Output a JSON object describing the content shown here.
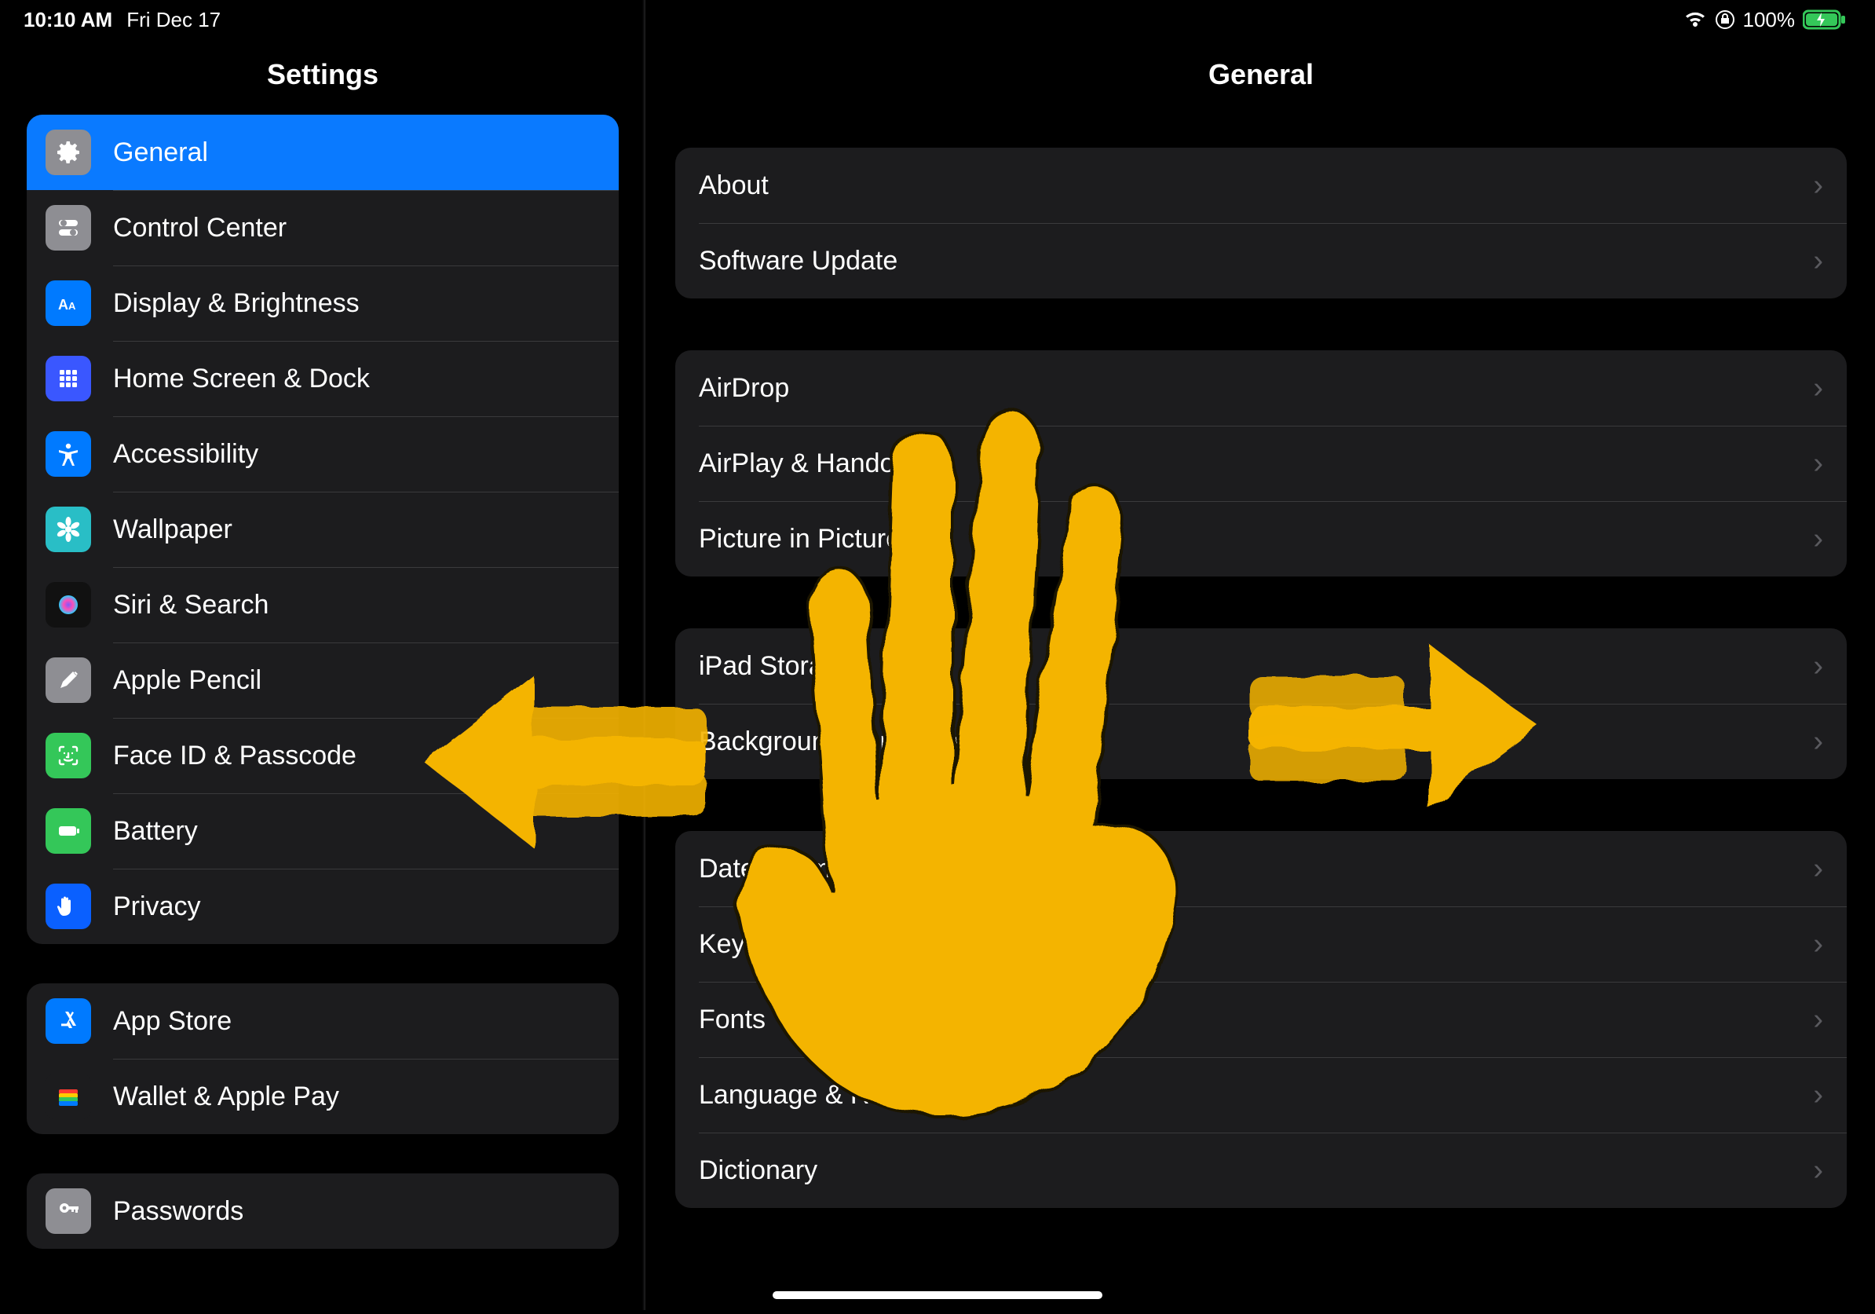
{
  "status": {
    "time": "10:10 AM",
    "date": "Fri Dec 17",
    "battery_percent": "100%",
    "battery_icon": "battery-charging-icon",
    "wifi_icon": "wifi-icon",
    "orientation_lock_icon": "orientation-lock-icon"
  },
  "sidebar": {
    "title": "Settings",
    "groups": [
      {
        "items": [
          {
            "icon": "gear-icon",
            "icon_bg": "ic-gray",
            "label": "General",
            "selected": true
          },
          {
            "icon": "toggles-icon",
            "icon_bg": "ic-gray2",
            "label": "Control Center",
            "selected": false
          },
          {
            "icon": "text-size-icon",
            "icon_bg": "ic-blue",
            "label": "Display & Brightness",
            "selected": false
          },
          {
            "icon": "grid-icon",
            "icon_bg": "ic-grid",
            "label": "Home Screen & Dock",
            "selected": false
          },
          {
            "icon": "accessibility-icon",
            "icon_bg": "ic-blue",
            "label": "Accessibility",
            "selected": false
          },
          {
            "icon": "flower-icon",
            "icon_bg": "ic-teal",
            "label": "Wallpaper",
            "selected": false
          },
          {
            "icon": "siri-icon",
            "icon_bg": "ic-black",
            "label": "Siri & Search",
            "selected": false
          },
          {
            "icon": "pencil-icon",
            "icon_bg": "ic-pencil",
            "label": "Apple Pencil",
            "selected": false
          },
          {
            "icon": "faceid-icon",
            "icon_bg": "ic-face",
            "label": "Face ID & Passcode",
            "selected": false
          },
          {
            "icon": "battery-icon",
            "icon_bg": "ic-green",
            "label": "Battery",
            "selected": false
          },
          {
            "icon": "hand-icon",
            "icon_bg": "ic-hand",
            "label": "Privacy",
            "selected": false
          }
        ]
      },
      {
        "items": [
          {
            "icon": "appstore-icon",
            "icon_bg": "ic-blue",
            "label": "App Store",
            "selected": false
          },
          {
            "icon": "wallet-icon",
            "icon_bg": "ic-wallet",
            "label": "Wallet & Apple Pay",
            "selected": false
          }
        ]
      },
      {
        "items": [
          {
            "icon": "key-icon",
            "icon_bg": "ic-key",
            "label": "Passwords",
            "selected": false
          }
        ]
      }
    ]
  },
  "detail": {
    "title": "General",
    "groups": [
      {
        "items": [
          {
            "label": "About"
          },
          {
            "label": "Software Update"
          }
        ]
      },
      {
        "items": [
          {
            "label": "AirDrop"
          },
          {
            "label": "AirPlay & Handoff"
          },
          {
            "label": "Picture in Picture"
          }
        ]
      },
      {
        "items": [
          {
            "label": "iPad Storage"
          },
          {
            "label": "Background App Refresh"
          }
        ]
      },
      {
        "items": [
          {
            "label": "Date & Time"
          },
          {
            "label": "Keyboard"
          },
          {
            "label": "Fonts"
          },
          {
            "label": "Language & Region"
          },
          {
            "label": "Dictionary"
          }
        ]
      }
    ]
  },
  "annotation": {
    "color": "#f4b400",
    "type": "hand-swipe-gesture",
    "arrows": [
      "left",
      "right"
    ]
  }
}
